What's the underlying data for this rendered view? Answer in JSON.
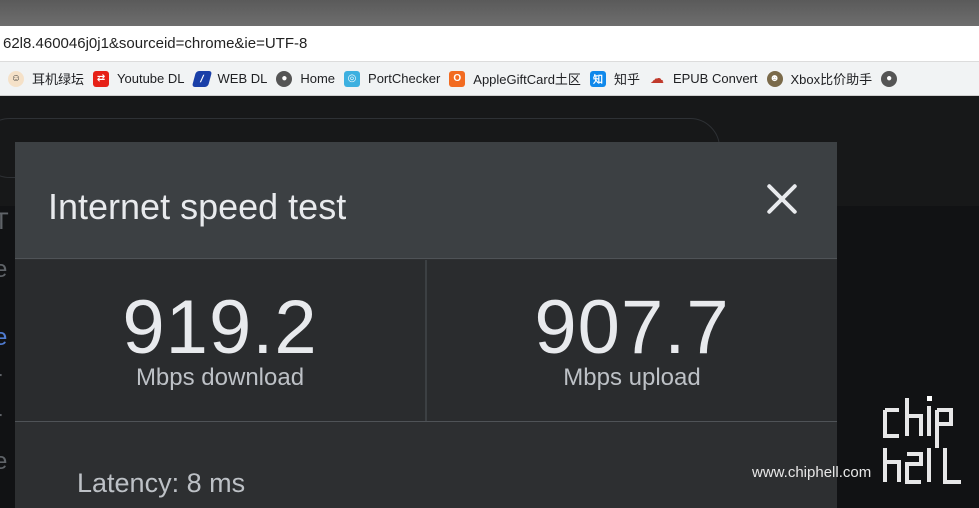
{
  "browser": {
    "url": "62l8.460046j0j1&sourceid=chrome&ie=UTF-8",
    "bookmarks": [
      {
        "label": "耳机绿坛",
        "icon": "face-icon",
        "color": "#333333"
      },
      {
        "label": "Youtube DL",
        "icon": "youtube-icon",
        "color": "#e62117"
      },
      {
        "label": "WEB DL",
        "icon": "webdl-icon",
        "color": "#1a3fa8"
      },
      {
        "label": "Home",
        "icon": "globe-icon",
        "color": "#555555"
      },
      {
        "label": "PortChecker",
        "icon": "pin-icon",
        "color": "#3db0e0"
      },
      {
        "label": "AppleGiftCard土区",
        "icon": "orange-icon",
        "color": "#f26b21"
      },
      {
        "label": "知乎",
        "icon": "zhihu-icon",
        "color": "#0f88eb"
      },
      {
        "label": "EPUB Convert",
        "icon": "cloud-icon",
        "color": "#c0392b"
      },
      {
        "label": "Xbox比价助手",
        "icon": "avatar-icon",
        "color": "#7a6a4a"
      }
    ]
  },
  "speedtest": {
    "title": "Internet speed test",
    "download_value": "919.2",
    "download_unit": "Mbps download",
    "upload_value": "907.7",
    "upload_unit": "Mbps upload",
    "latency": "Latency: 8 ms"
  },
  "watermark": {
    "site": "www.chiphell.com"
  }
}
